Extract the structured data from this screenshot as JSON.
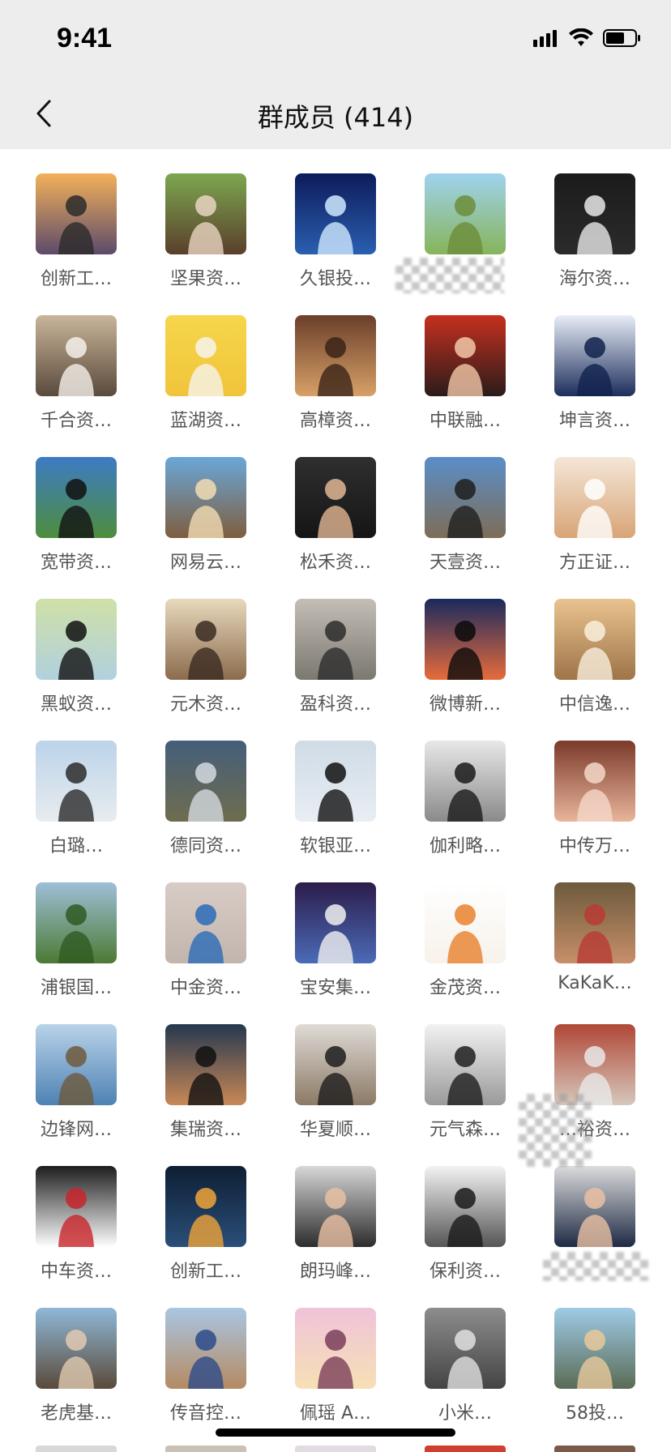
{
  "status": {
    "time": "9:41"
  },
  "nav": {
    "title": "群成员 (414)"
  },
  "members": [
    {
      "name": "创新工…",
      "bg1": "#f3b15a",
      "bg2": "#5c4a6b",
      "accent": "#2b2b2b"
    },
    {
      "name": "坚果资…",
      "bg1": "#7da750",
      "bg2": "#5a3f2b",
      "accent": "#e9d4c2"
    },
    {
      "name": "久银投…",
      "bg1": "#0d1b5a",
      "bg2": "#2a5fb0",
      "accent": "#cfe9ff"
    },
    {
      "name": "",
      "bg1": "#9fd3ee",
      "bg2": "#87b45a",
      "accent": "#6c8d3a"
    },
    {
      "name": "海尔资…",
      "bg1": "#1b1b1b",
      "bg2": "#2b2b2b",
      "accent": "#e8e8e8"
    },
    {
      "name": "千合资…",
      "bg1": "#c9b59a",
      "bg2": "#5a4a3c",
      "accent": "#f4f0ea"
    },
    {
      "name": "蓝湖资…",
      "bg1": "#f6d64b",
      "bg2": "#f0c43a",
      "accent": "#f7f4ec"
    },
    {
      "name": "高樟资…",
      "bg1": "#6b3f2a",
      "bg2": "#d8a068",
      "accent": "#3a2418"
    },
    {
      "name": "中联融…",
      "bg1": "#c6301f",
      "bg2": "#2a1c1a",
      "accent": "#f2c7a8"
    },
    {
      "name": "坤言资…",
      "bg1": "#e8eef7",
      "bg2": "#1d2e5c",
      "accent": "#10224d"
    },
    {
      "name": "宽带资…",
      "bg1": "#3d7bc4",
      "bg2": "#4e8d3d",
      "accent": "#111111"
    },
    {
      "name": "网易云…",
      "bg1": "#6aa7d8",
      "bg2": "#7e5e3f",
      "accent": "#f2dcb3"
    },
    {
      "name": "松禾资…",
      "bg1": "#2f2f2f",
      "bg2": "#151515",
      "accent": "#e2b794"
    },
    {
      "name": "天壹资…",
      "bg1": "#5a8ec8",
      "bg2": "#7d6d56",
      "accent": "#1f1f1f"
    },
    {
      "name": "方正证…",
      "bg1": "#f4e7d8",
      "bg2": "#d8a476",
      "accent": "#ffffff"
    },
    {
      "name": "黑蚁资…",
      "bg1": "#cfe0a7",
      "bg2": "#b1d0de",
      "accent": "#111111"
    },
    {
      "name": "元木资…",
      "bg1": "#e8d9bd",
      "bg2": "#8c6b4d",
      "accent": "#3a2b22"
    },
    {
      "name": "盈科资…",
      "bg1": "#c4bfb6",
      "bg2": "#7b786f",
      "accent": "#2d2d2d"
    },
    {
      "name": "微博新…",
      "bg1": "#1a2a5e",
      "bg2": "#e76b3b",
      "accent": "#0b0b0b"
    },
    {
      "name": "中信逸…",
      "bg1": "#e9c38f",
      "bg2": "#9e7448",
      "accent": "#f9eedc"
    },
    {
      "name": "白璐…",
      "bg1": "#bcd3ea",
      "bg2": "#e8ecef",
      "accent": "#2b2b2b"
    },
    {
      "name": "德同资…",
      "bg1": "#445e7a",
      "bg2": "#6f6d4f",
      "accent": "#d3d9e0"
    },
    {
      "name": "软银亚…",
      "bg1": "#cfdbe6",
      "bg2": "#e8eef3",
      "accent": "#111111"
    },
    {
      "name": "伽利略…",
      "bg1": "#e8e8e8",
      "bg2": "#8a8a8a",
      "accent": "#1a1a1a"
    },
    {
      "name": "中传万…",
      "bg1": "#7b3a2a",
      "bg2": "#e8b59b",
      "accent": "#f5d7c8"
    },
    {
      "name": "浦银国…",
      "bg1": "#9ebfd8",
      "bg2": "#4c7a34",
      "accent": "#2f5a22"
    },
    {
      "name": "中金资…",
      "bg1": "#d8ccc6",
      "bg2": "#c2b5ad",
      "accent": "#2a6bb8"
    },
    {
      "name": "宝安集…",
      "bg1": "#2c1c4a",
      "bg2": "#4b6bb8",
      "accent": "#f0f0f0"
    },
    {
      "name": "金茂资…",
      "bg1": "#ffffff",
      "bg2": "#f7f2ea",
      "accent": "#e9812e"
    },
    {
      "name": "KaKaK…",
      "bg1": "#6c5a3c",
      "bg2": "#c78f6a",
      "accent": "#b73b35"
    },
    {
      "name": "边锋网…",
      "bg1": "#b9d3ea",
      "bg2": "#4e82b3",
      "accent": "#6e5a3c"
    },
    {
      "name": "集瑞资…",
      "bg1": "#25384f",
      "bg2": "#c98857",
      "accent": "#111111"
    },
    {
      "name": "华夏顺…",
      "bg1": "#e0dbd6",
      "bg2": "#8b7a66",
      "accent": "#1d1d1d"
    },
    {
      "name": "元气森…",
      "bg1": "#f2f2f2",
      "bg2": "#9a9a9a",
      "accent": "#1e1e1e"
    },
    {
      "name": "…裕资…",
      "bg1": "#b04736",
      "bg2": "#d6c8bc",
      "accent": "#e8e8e8"
    },
    {
      "name": "中车资…",
      "bg1": "#1d1d1d",
      "bg2": "#ffffff",
      "accent": "#c8242b"
    },
    {
      "name": "创新工…",
      "bg1": "#0e1e33",
      "bg2": "#2a4f79",
      "accent": "#f0a43a"
    },
    {
      "name": "朗玛峰…",
      "bg1": "#d8d8d8",
      "bg2": "#2c2c2c",
      "accent": "#e9c1a4"
    },
    {
      "name": "保利资…",
      "bg1": "#f3f3f3",
      "bg2": "#555555",
      "accent": "#1a1a1a"
    },
    {
      "name": "",
      "bg1": "#dcdcdc",
      "bg2": "#1e2a44",
      "accent": "#eac0a3"
    },
    {
      "name": "老虎基…",
      "bg1": "#8fb8d8",
      "bg2": "#5a4a3a",
      "accent": "#e0c9b0"
    },
    {
      "name": "传音控…",
      "bg1": "#a9c6e3",
      "bg2": "#b58a62",
      "accent": "#2d4b8a"
    },
    {
      "name": "佩瑶 A…",
      "bg1": "#f0c3d9",
      "bg2": "#f6e0b5",
      "accent": "#7a3e5a"
    },
    {
      "name": "小米…",
      "bg1": "#8d8d8d",
      "bg2": "#444444",
      "accent": "#e0e0e0"
    },
    {
      "name": "58投…",
      "bg1": "#9fcbe8",
      "bg2": "#5a6b54",
      "accent": "#e8c99c"
    }
  ]
}
